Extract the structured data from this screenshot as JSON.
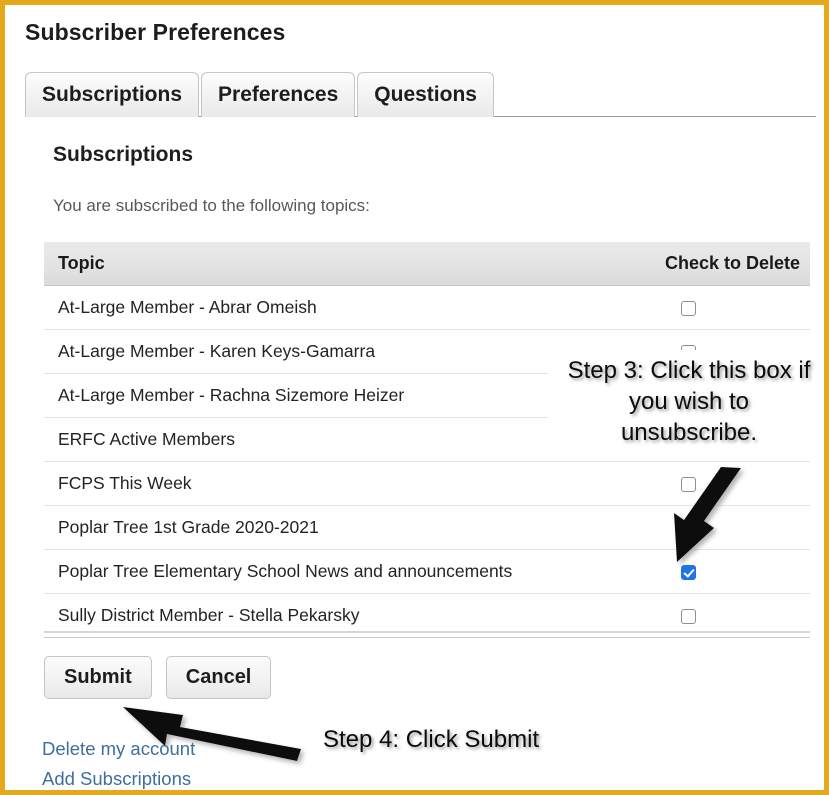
{
  "window": {
    "title": "Subscriber Preferences",
    "border_color": "#e3a81c"
  },
  "tabs": [
    {
      "label": "Subscriptions",
      "selected": true
    },
    {
      "label": "Preferences",
      "selected": false
    },
    {
      "label": "Questions",
      "selected": false
    }
  ],
  "panel": {
    "heading": "Subscriptions",
    "subheading": "You are subscribed to the following topics:"
  },
  "table": {
    "columns": [
      "Topic",
      "Check to Delete"
    ],
    "rows": [
      {
        "topic": "At-Large Member - Abrar Omeish",
        "checked": false
      },
      {
        "topic": "At-Large Member - Karen Keys-Gamarra",
        "checked": false
      },
      {
        "topic": "At-Large Member - Rachna Sizemore Heizer",
        "checked": false
      },
      {
        "topic": "ERFC Active Members",
        "checked": false
      },
      {
        "topic": "FCPS This Week",
        "checked": false
      },
      {
        "topic": "Poplar Tree 1st Grade 2020-2021",
        "checked": false
      },
      {
        "topic": "Poplar Tree Elementary School News and announcements",
        "checked": true
      },
      {
        "topic": "Sully District Member - Stella Pekarsky",
        "checked": false
      }
    ]
  },
  "buttons": {
    "submit": "Submit",
    "cancel": "Cancel"
  },
  "links": [
    {
      "label": "Delete my account"
    },
    {
      "label": "Add Subscriptions"
    }
  ],
  "annotations": [
    {
      "id": "step3",
      "text": "Step 3: Click this box if you wish to unsubscribe.",
      "color": "#0b0b0b"
    },
    {
      "id": "step4",
      "text": "Step 4: Click Submit",
      "color": "#0b0b0b"
    }
  ],
  "colors": {
    "accent_border": "#e3a81c",
    "checkbox_checked": "#1f73e8",
    "link": "#3e6f9e",
    "arrow": "#000000"
  }
}
